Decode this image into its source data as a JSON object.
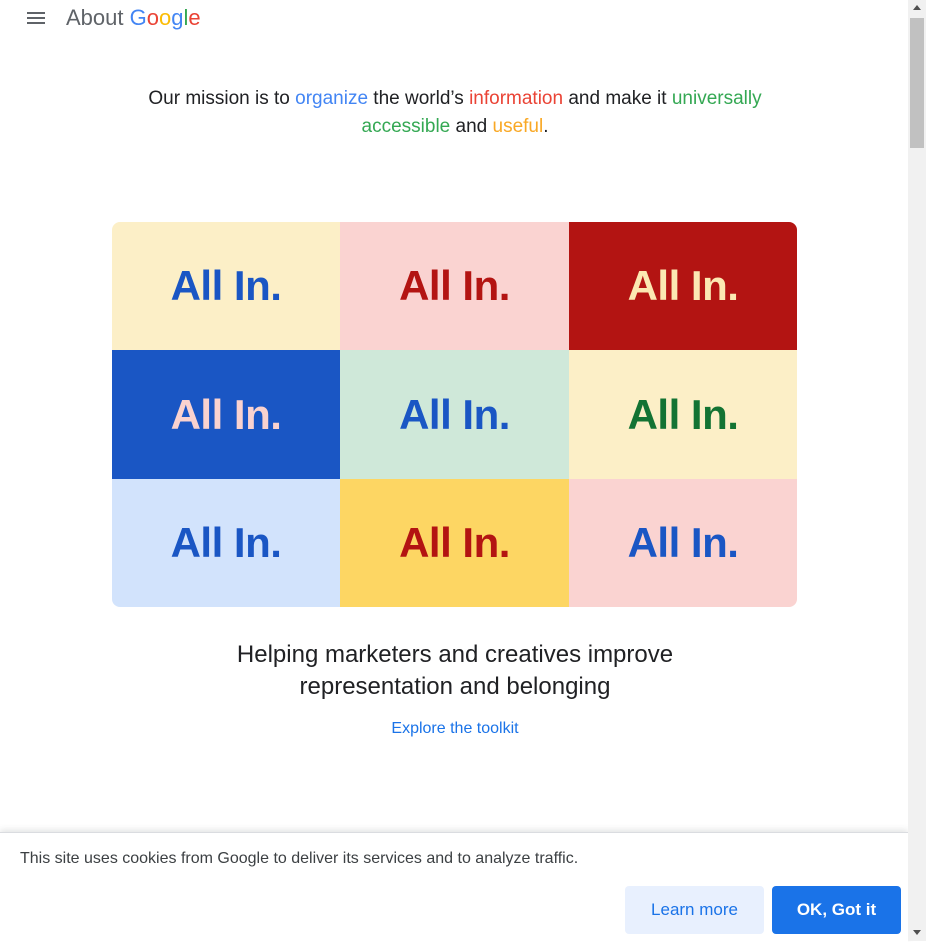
{
  "header": {
    "brand_about": "About",
    "brand_google_letters": [
      "G",
      "o",
      "o",
      "g",
      "l",
      "e"
    ],
    "menu_icon": "hamburger-menu-icon"
  },
  "mission": {
    "p1": "Our mission is to ",
    "organize": "organize",
    "p2": " the world’s ",
    "information": "information",
    "p3": " and make it ",
    "universally": "universally",
    "accessible": "accessible",
    "p4": " and ",
    "useful": "useful",
    "p5": "."
  },
  "grid": {
    "tiles": [
      {
        "label": "All In.",
        "bg": "#fcefc7",
        "fg": "#1a56c4"
      },
      {
        "label": "All In.",
        "bg": "#fad3d1",
        "fg": "#b31412"
      },
      {
        "label": "All In.",
        "bg": "#b31412",
        "fg": "#fce8b2"
      },
      {
        "label": "All In.",
        "bg": "#1a56c4",
        "fg": "#fad2cf"
      },
      {
        "label": "All In.",
        "bg": "#cfe8d9",
        "fg": "#1a56c4"
      },
      {
        "label": "All In.",
        "bg": "#fcefc7",
        "fg": "#137333"
      },
      {
        "label": "All In.",
        "bg": "#d2e3fc",
        "fg": "#1a56c4"
      },
      {
        "label": "All In.",
        "bg": "#fdd663",
        "fg": "#b31412"
      },
      {
        "label": "All In.",
        "bg": "#fad3d1",
        "fg": "#1a56c4"
      }
    ]
  },
  "tagline": {
    "line1": "Helping marketers and creatives improve",
    "line2": "representation and belonging"
  },
  "explore_link": "Explore the toolkit",
  "cookie": {
    "text": "This site uses cookies from Google to deliver its services and to analyze traffic.",
    "learn_more": "Learn more",
    "ok": "OK, Got it"
  },
  "colors": {
    "accent": "#1a73e8",
    "google_blue": "#4285f4",
    "google_red": "#ea4335",
    "google_yellow": "#fbbc05",
    "google_green": "#34a853"
  }
}
